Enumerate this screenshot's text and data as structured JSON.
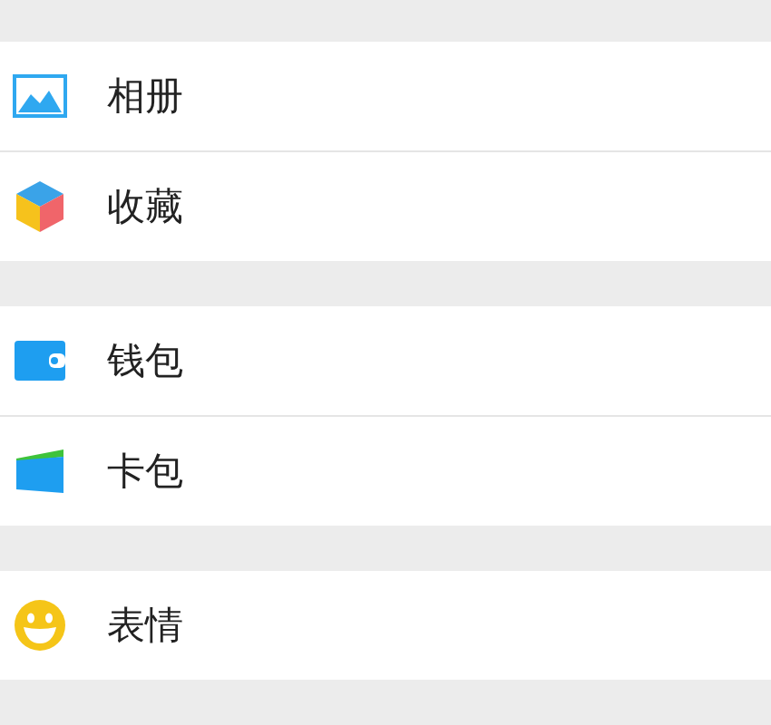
{
  "groups": [
    {
      "items": [
        {
          "kind": "photos",
          "label": "相册"
        },
        {
          "kind": "favorites",
          "label": "收藏"
        }
      ]
    },
    {
      "items": [
        {
          "kind": "wallet",
          "label": "钱包"
        },
        {
          "kind": "cards",
          "label": "卡包"
        }
      ]
    },
    {
      "items": [
        {
          "kind": "stickers",
          "label": "表情"
        }
      ]
    }
  ]
}
